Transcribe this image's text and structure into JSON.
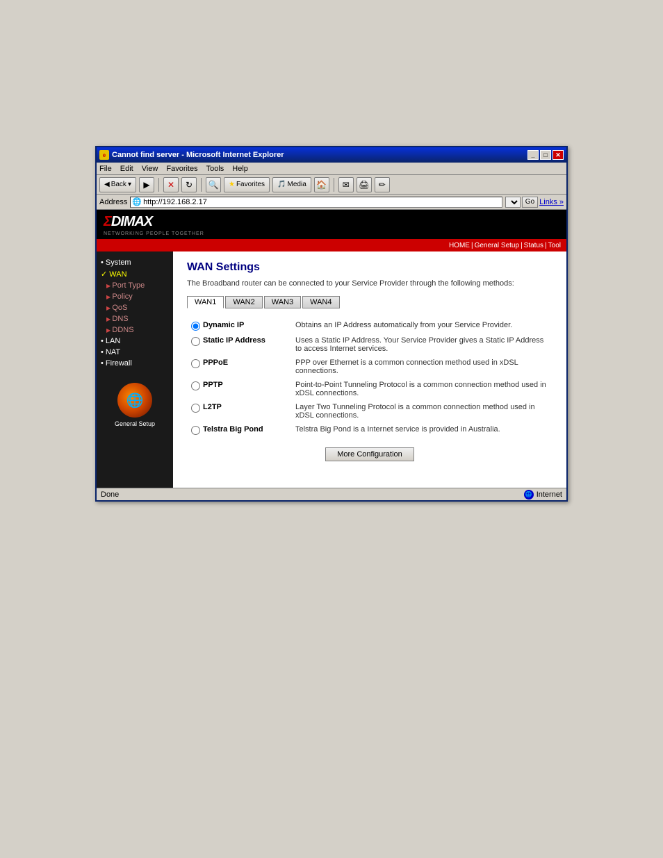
{
  "browser": {
    "title": "Cannot find server - Microsoft Internet Explorer",
    "address": "http://192.168.2.17",
    "menu_items": [
      "File",
      "Edit",
      "View",
      "Favorites",
      "Tools",
      "Help"
    ],
    "toolbar_buttons": [
      "Back",
      "Forward"
    ],
    "go_label": "Go",
    "links_label": "Links »",
    "status_left": "Done",
    "status_right": "Internet"
  },
  "router": {
    "brand": "EDIMAX",
    "brand_prefix": "Σ",
    "brand_suffix": "DIMAX",
    "tagline": "NETWORKING PEOPLE TOGETHER",
    "nav": {
      "home": "HOME",
      "general_setup": "General Setup",
      "status": "Status",
      "tool": "Tool"
    },
    "sidebar": {
      "items": [
        {
          "id": "system",
          "label": "System",
          "type": "bullet"
        },
        {
          "id": "wan",
          "label": "WAN",
          "type": "checked_active"
        },
        {
          "id": "port-type",
          "label": "Port Type",
          "type": "arrow"
        },
        {
          "id": "policy",
          "label": "Policy",
          "type": "arrow"
        },
        {
          "id": "qos",
          "label": "QoS",
          "type": "arrow"
        },
        {
          "id": "dns",
          "label": "DNS",
          "type": "arrow"
        },
        {
          "id": "ddns",
          "label": "DDNS",
          "type": "arrow"
        },
        {
          "id": "lan",
          "label": "LAN",
          "type": "bullet"
        },
        {
          "id": "nat",
          "label": "NAT",
          "type": "bullet"
        },
        {
          "id": "firewall",
          "label": "Firewall",
          "type": "bullet"
        }
      ],
      "logo_text": "General Setup"
    },
    "content": {
      "title": "WAN Settings",
      "description": "The Broadband router can be connected to your Service Provider through the following methods:",
      "tabs": [
        "WAN1",
        "WAN2",
        "WAN3",
        "WAN4"
      ],
      "active_tab": "WAN1",
      "options": [
        {
          "id": "dynamic-ip",
          "label": "Dynamic IP",
          "description": "Obtains an IP Address automatically from your Service Provider.",
          "selected": true
        },
        {
          "id": "static-ip",
          "label": "Static IP Address",
          "description": "Uses a Static IP Address. Your Service Provider gives a Static IP Address to access Internet services.",
          "selected": false
        },
        {
          "id": "pppoe",
          "label": "PPPoE",
          "description": "PPP over Ethernet is a common connection method used in xDSL connections.",
          "selected": false
        },
        {
          "id": "pptp",
          "label": "PPTP",
          "description": "Point-to-Point Tunneling Protocol is a common connection method used in xDSL connections.",
          "selected": false
        },
        {
          "id": "l2tp",
          "label": "L2TP",
          "description": "Layer Two Tunneling Protocol is a common connection method used in xDSL connections.",
          "selected": false
        },
        {
          "id": "telstra",
          "label": "Telstra Big Pond",
          "description": "Telstra Big Pond is a Internet service is provided in Australia.",
          "selected": false
        }
      ],
      "more_config_btn": "More Configuration"
    }
  }
}
